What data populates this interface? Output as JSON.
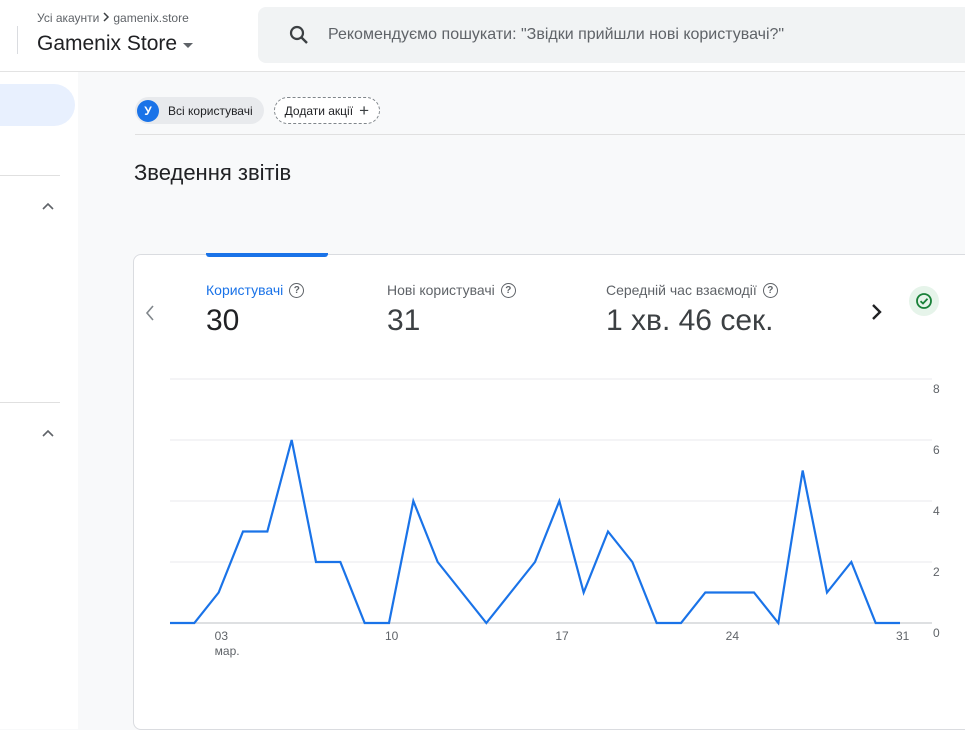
{
  "header": {
    "breadcrumb_root": "Усі акаунти",
    "breadcrumb_child": "gamenix.store",
    "property_name": "Gamenix Store",
    "search_placeholder": "Рекомендуємо пошукати: \"Звідки прийшли нові користувачі?\""
  },
  "filters": {
    "all_users_avatar": "У",
    "all_users_label": "Всі користувачі",
    "add_comparison_label": "Додати акції"
  },
  "section_title": "Зведення звітів",
  "metrics": [
    {
      "label": "Користувачі",
      "value": "30"
    },
    {
      "label": "Нові користувачі",
      "value": "31"
    },
    {
      "label": "Середній час взаємодії",
      "value": "1 хв. 46 сек."
    }
  ],
  "colors": {
    "accent": "#1a73e8",
    "success": "#188038"
  },
  "icons": [
    "search-icon",
    "chevron-right-icon",
    "caret-down-icon",
    "plus-icon",
    "help-icon",
    "chevron-left-icon",
    "check-circle-icon",
    "chevron-up-icon"
  ],
  "chart_data": {
    "type": "line",
    "x": [
      1,
      2,
      3,
      4,
      5,
      6,
      7,
      8,
      9,
      10,
      11,
      12,
      13,
      14,
      15,
      16,
      17,
      18,
      19,
      20,
      21,
      22,
      23,
      24,
      25,
      26,
      27,
      28,
      29,
      30,
      31
    ],
    "series": [
      {
        "values": [
          0,
          0,
          1,
          3,
          3,
          6,
          2,
          2,
          0,
          0,
          4,
          2,
          1,
          0,
          1,
          2,
          4,
          1,
          3,
          2,
          0,
          0,
          1,
          1,
          1,
          0,
          5,
          1,
          2,
          0,
          0
        ]
      }
    ],
    "x_tick_labels": [
      {
        "x": 3,
        "label": "03",
        "sublabel": "мар."
      },
      {
        "x": 10,
        "label": "10"
      },
      {
        "x": 17,
        "label": "17"
      },
      {
        "x": 24,
        "label": "24"
      },
      {
        "x": 31,
        "label": "31"
      }
    ],
    "y_ticks": [
      0,
      2,
      4,
      6,
      8
    ],
    "ylim": [
      0,
      8
    ],
    "grid": true
  }
}
